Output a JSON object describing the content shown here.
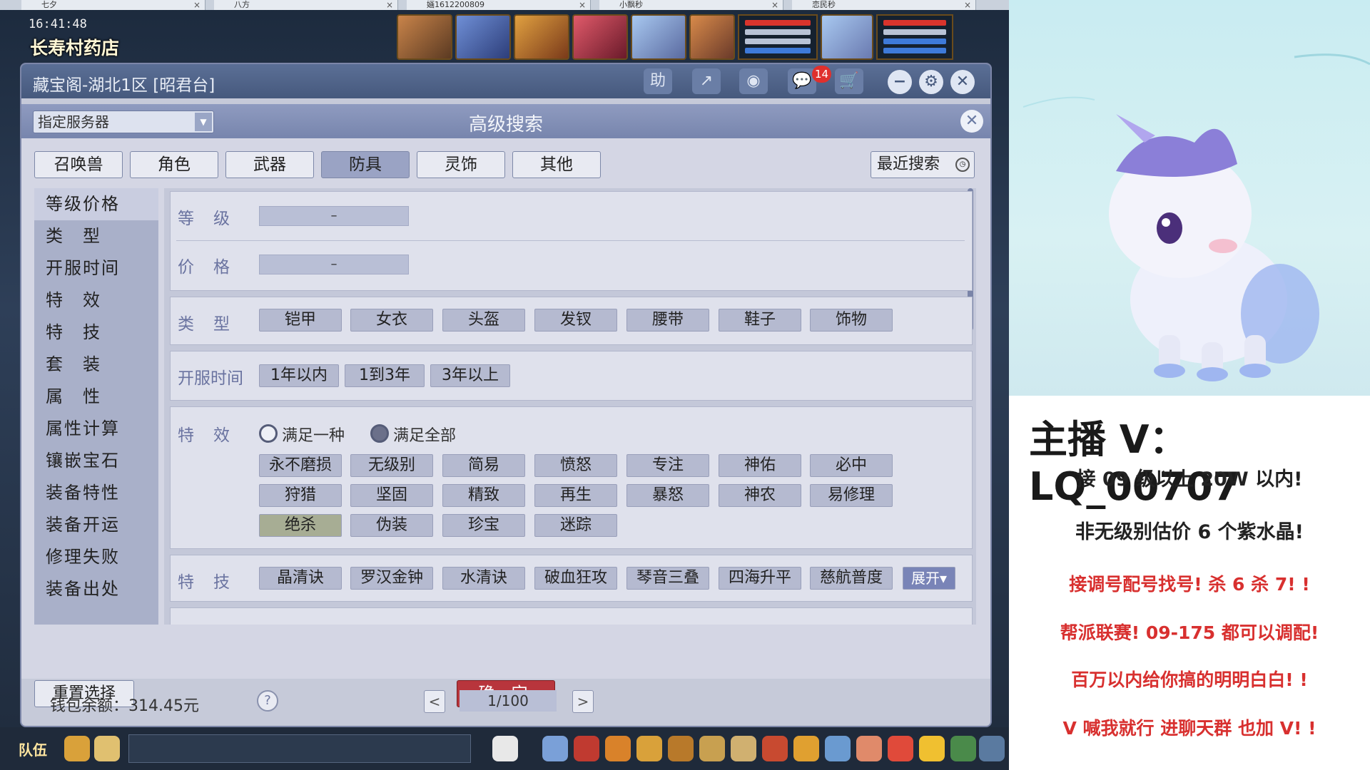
{
  "game": {
    "tabs": [
      {
        "label": "七夕"
      },
      {
        "label": "八方"
      },
      {
        "label": "婳1612200809"
      },
      {
        "label": "小飘秒"
      },
      {
        "label": "恋民秒"
      }
    ],
    "clock": "16:41:48",
    "location": "长寿村药店",
    "team_label": "队伍"
  },
  "dialog": {
    "title": "藏宝阁-湖北1区 [昭君台]",
    "titlebar_buttons": {
      "help": "助",
      "share": "↗",
      "record": "◉",
      "chat": "💬",
      "cart": "🛒"
    },
    "message_count": "14",
    "window_controls": {
      "minimize": "−",
      "settings": "⚙",
      "close": "✕"
    }
  },
  "search": {
    "server_select": "指定服务器",
    "title": "高级搜索",
    "category_tabs": [
      {
        "label": "召唤兽"
      },
      {
        "label": "角色"
      },
      {
        "label": "武器"
      },
      {
        "label": "防具"
      },
      {
        "label": "灵饰"
      },
      {
        "label": "其他"
      }
    ],
    "recent_search": "最近搜索",
    "left_nav": [
      "等级价格",
      "类　型",
      "开服时间",
      "特　效",
      "特　技",
      "套　装",
      "属　性",
      "属性计算",
      "镶嵌宝石",
      "装备特性",
      "装备开运",
      "修理失败",
      "装备出处"
    ],
    "level_label": "等　级",
    "level_range": "–",
    "price_label": "价　格",
    "price_range": "–",
    "type_label": "类　型",
    "types": [
      "铠甲",
      "女衣",
      "头盔",
      "发钗",
      "腰带",
      "鞋子",
      "饰物"
    ],
    "server_time_label": "开服时间",
    "server_times": [
      "1年以内",
      "1到3年",
      "3年以上"
    ],
    "effect_label": "特　效",
    "effect_modes": [
      "满足一种",
      "满足全部"
    ],
    "effects_row1": [
      "永不磨损",
      "无级别",
      "简易",
      "愤怒",
      "专注",
      "神佑",
      "必中"
    ],
    "effects_row2": [
      "狩猎",
      "坚固",
      "精致",
      "再生",
      "暴怒",
      "神农",
      "易修理"
    ],
    "effects_row3": [
      "绝杀",
      "伪装",
      "珍宝",
      "迷踪"
    ],
    "skill_label": "特　技",
    "skills": [
      "晶清诀",
      "罗汉金钟",
      "水清诀",
      "破血狂攻",
      "琴音三叠",
      "四海升平",
      "慈航普度"
    ],
    "expand": "展开▾",
    "reset": "重置选择",
    "confirm": "确 定"
  },
  "footer": {
    "wallet": "钱包余额：314.45元",
    "help": "?",
    "prev": "<",
    "page": "1/100",
    "next": ">"
  },
  "stream": {
    "anchor": "主播 V：LQ_00707",
    "lines_dark": [
      "接 09 级以上 20W 以内!",
      "非无级别估价 6 个紫水晶!"
    ],
    "lines_red": [
      "接调号配号找号! 杀 6 杀 7! !",
      "帮派联赛! 09-175 都可以调配!",
      "百万以内给你搞的明明白白! !",
      "V 喊我就行  进聊天群 也加 V! !"
    ]
  },
  "colors": {
    "titlebar": "#46597d",
    "panel": "#d4d6e4",
    "confirm": "#b8353c",
    "accent_red": "#d8302f"
  }
}
